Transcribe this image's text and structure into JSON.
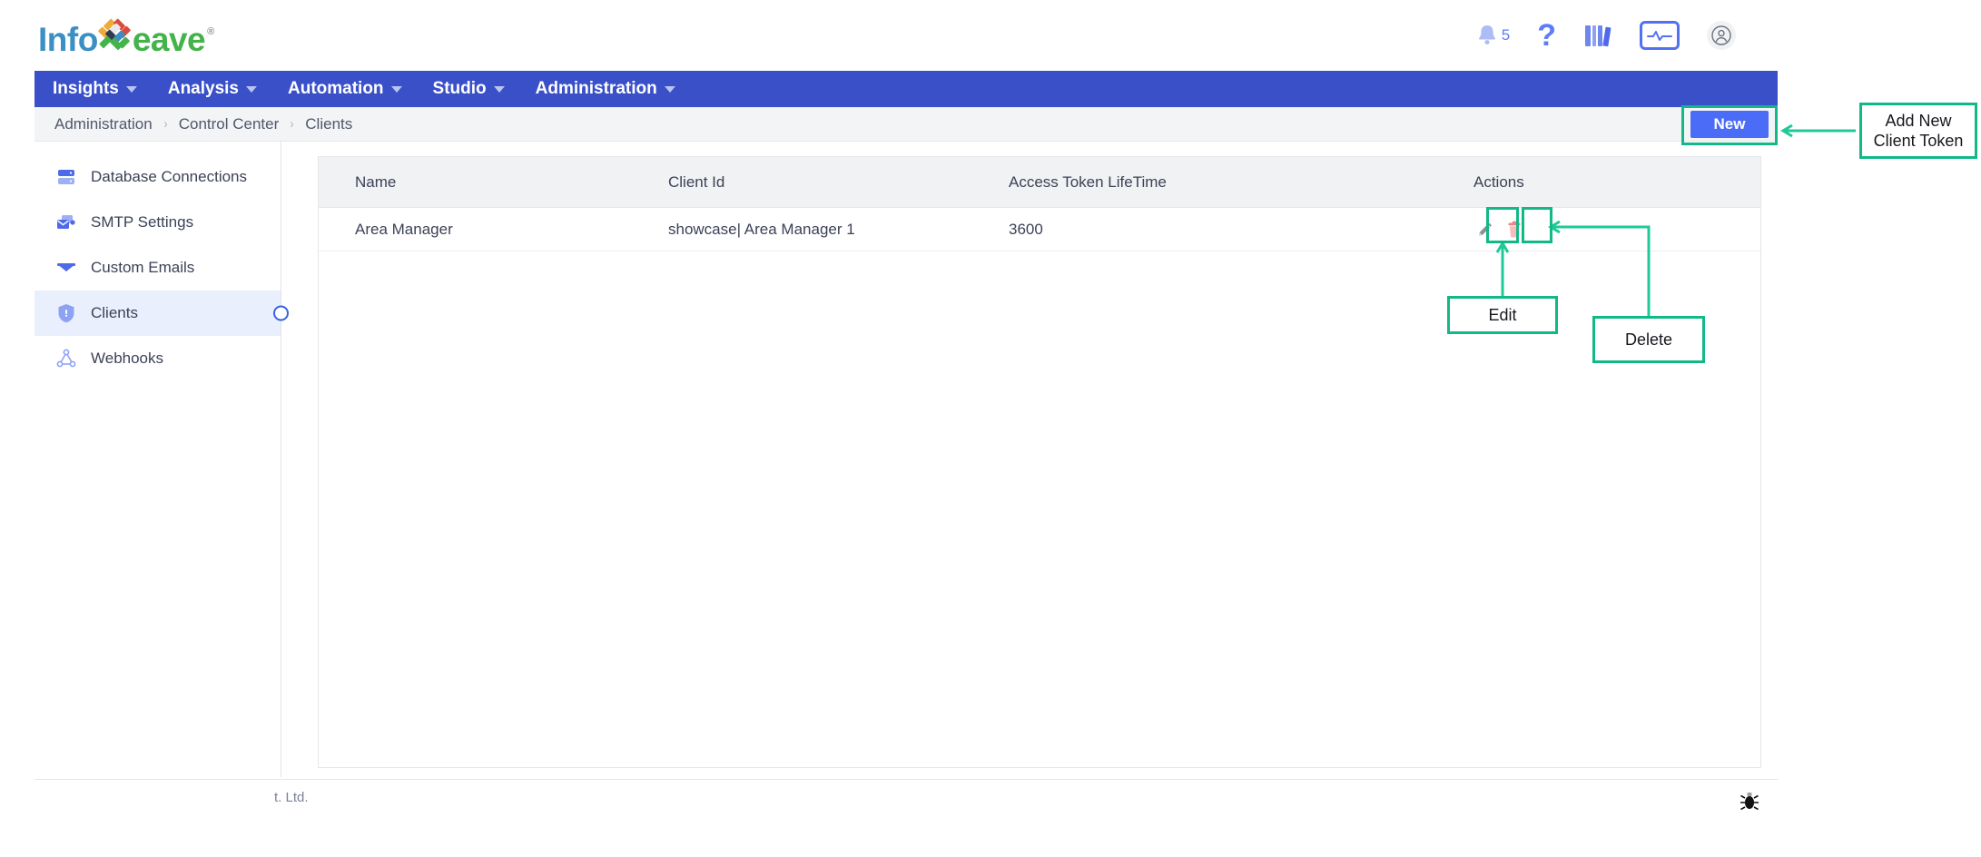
{
  "header": {
    "logo": {
      "part1": "Info",
      "part2": "eave",
      "registered": "®",
      "mark": "woven-w-logo"
    },
    "icons": [
      {
        "name": "notifications-bell-icon",
        "badge": "5"
      },
      {
        "name": "help-question-icon"
      },
      {
        "name": "library-books-icon"
      },
      {
        "name": "monitor-activity-icon"
      },
      {
        "name": "user-account-icon"
      }
    ]
  },
  "nav": {
    "items": [
      {
        "label": "Insights",
        "has_caret": true
      },
      {
        "label": "Analysis",
        "has_caret": true
      },
      {
        "label": "Automation",
        "has_caret": true
      },
      {
        "label": "Studio",
        "has_caret": true
      },
      {
        "label": "Administration",
        "has_caret": true
      }
    ]
  },
  "breadcrumb": {
    "items": [
      "Administration",
      "Control Center",
      "Clients"
    ],
    "separator": "›"
  },
  "sidebar": {
    "items": [
      {
        "label": "Database Connections",
        "icon": "database-server-icon",
        "active": false
      },
      {
        "label": "SMTP Settings",
        "icon": "smtp-mail-settings-icon",
        "active": false
      },
      {
        "label": "Custom Emails",
        "icon": "envelope-icon",
        "active": false
      },
      {
        "label": "Clients",
        "icon": "shield-icon",
        "active": true
      },
      {
        "label": "Webhooks",
        "icon": "webhook-nodes-icon",
        "active": false
      }
    ]
  },
  "toolbar": {
    "new_label": "New"
  },
  "table": {
    "columns": [
      "Name",
      "Client Id",
      "Access Token LifeTime",
      "Actions"
    ],
    "rows": [
      {
        "name": "Area Manager",
        "client_id": "showcase| Area Manager 1",
        "lifetime": "3600",
        "actions": [
          "edit-icon",
          "delete-icon"
        ]
      }
    ]
  },
  "annotations": [
    {
      "id": "new",
      "text": "Add New\nClient Token",
      "line1": "Add New",
      "line2": "Client Token"
    },
    {
      "id": "edit",
      "text": "Edit",
      "line1": "Edit"
    },
    {
      "id": "delete",
      "text": "Delete",
      "line1": "Delete"
    }
  ],
  "footer": {
    "text": "t. Ltd.",
    "debug_icon": "bug-icon"
  },
  "colors": {
    "nav_blue": "#3a50c9",
    "button_blue": "#4a6cf7",
    "annotation_green": "#12b886",
    "sidebar_active": "#e9effd",
    "table_header": "#f1f2f4",
    "logo_blue": "#3a8fc4",
    "logo_green": "#43b34a",
    "delete_red": "#f6a6a6"
  }
}
